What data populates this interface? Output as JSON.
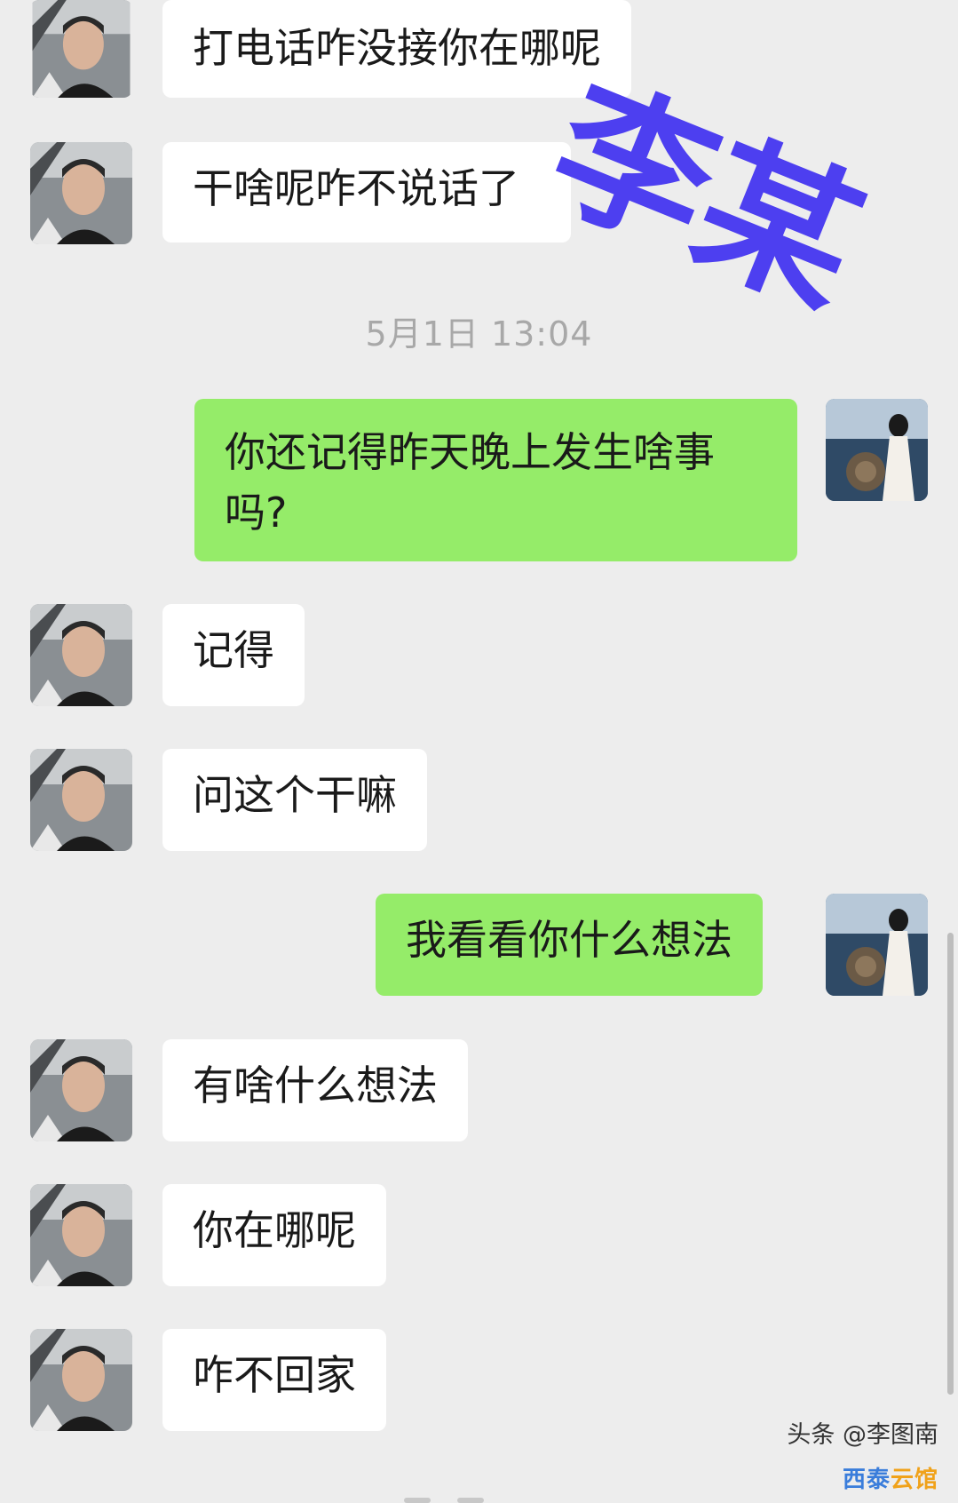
{
  "conversation": {
    "messages": [
      {
        "side": "left",
        "text": "打电话咋没接你在哪呢"
      },
      {
        "side": "left",
        "text": "干啥呢咋不说话了"
      },
      {
        "side": "right",
        "text": "你还记得昨天晚上发生啥事吗?"
      },
      {
        "side": "left",
        "text": "记得"
      },
      {
        "side": "left",
        "text": "问这个干嘛"
      },
      {
        "side": "right",
        "text": "我看看你什么想法"
      },
      {
        "side": "left",
        "text": "有啥什么想法"
      },
      {
        "side": "left",
        "text": "你在哪呢"
      },
      {
        "side": "left",
        "text": "咋不回家"
      }
    ],
    "timestamp": "5月1日 13:04"
  },
  "overlay": {
    "stamp_text": "李某",
    "stamp_color": "#4d3ff0"
  },
  "watermark": {
    "source_text": "头条 @李图南",
    "logo_text_a": "西泰",
    "logo_text_b": "云馆"
  },
  "colors": {
    "background": "#ededed",
    "incoming_bubble": "#ffffff",
    "outgoing_bubble": "#95ec69"
  },
  "icons": {
    "contact_avatar": "man-avatar-icon",
    "self_avatar": "woman-avatar-icon"
  }
}
